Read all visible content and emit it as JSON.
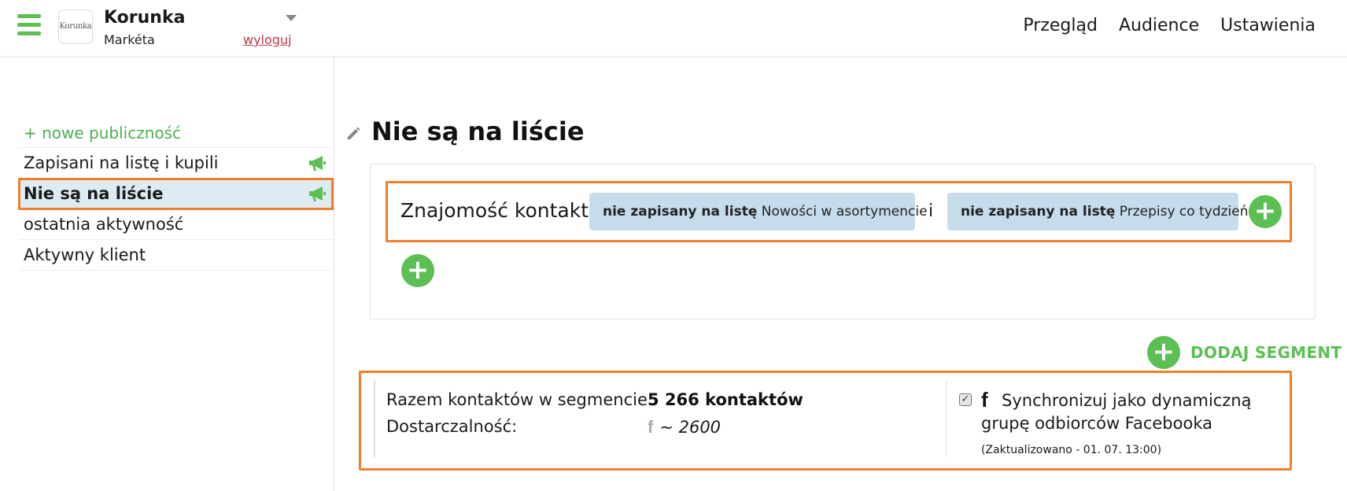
{
  "header": {
    "logo_text": "Korunka",
    "account_name": "Korunka",
    "user_name": "Markéta",
    "logout_label": "wyloguj",
    "nav": [
      "Przegląd",
      "Audience",
      "Ustawienia"
    ]
  },
  "sidebar": {
    "new_audience_label": "+ nowe publiczność",
    "items": [
      {
        "label": "Zapisani na listę i kupili",
        "icon": "megaphone-icon"
      },
      {
        "label": "Nie są na liście",
        "icon": "megaphone-icon",
        "active": true
      },
      {
        "label": "ostatnia aktywność"
      },
      {
        "label": "Aktywny klient"
      }
    ]
  },
  "main": {
    "title": "Nie są na liście",
    "condition": {
      "label": "Znajomość kontaktu",
      "chips": [
        {
          "bold": "nie zapisany na listę",
          "text": "Nowości w asortymencie"
        },
        {
          "bold": "nie zapisany na listę",
          "text": "Przepisy co tydzień"
        }
      ],
      "connector": "i"
    },
    "add_segment_label": "DODAJ SEGMENT",
    "stats": {
      "total_label": "Razem kontaktów w segmencie:",
      "total_value": "5 266 kontaktów",
      "delivery_label": "Dostarczalność:",
      "delivery_value": "~ 2600",
      "sync_label": "Synchronizuj jako dynamiczną grupę odbiorców Facebooka",
      "sync_checked": true,
      "updated": "(Zaktualizowano - 01. 07. 13:00)"
    }
  },
  "colors": {
    "accent_green": "#5cbf54",
    "highlight_orange": "#f07f2b",
    "chip_blue": "#c7dcea",
    "active_row": "#deebf3",
    "logout_red": "#c0394b"
  }
}
